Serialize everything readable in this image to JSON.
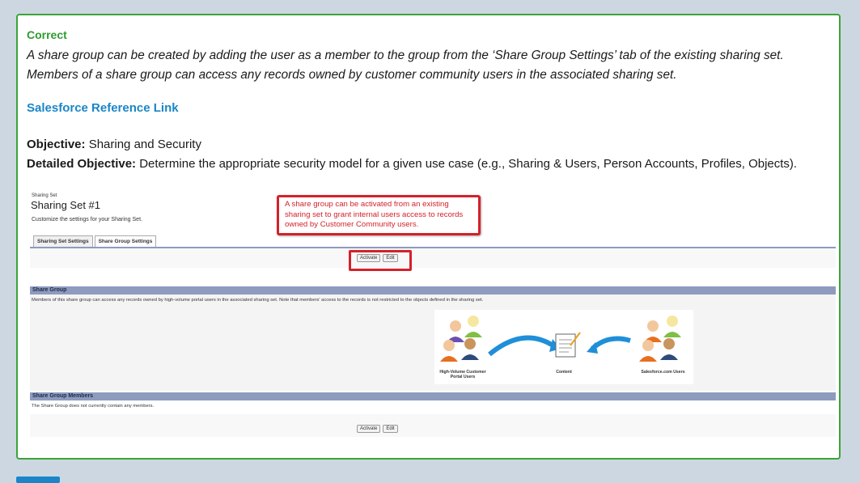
{
  "answer": {
    "status": "Correct",
    "explanation_line1": "A share group can be created by adding the user as a member to the group from the ‘Share Group Settings’ tab of the existing sharing set.",
    "explanation_line2": "Members of a share group can access any records owned by customer community users in the associated sharing set.",
    "reference_link": "Salesforce Reference Link",
    "objective_label": "Objective:",
    "objective_value": " Sharing and Security",
    "detailed_label": "Detailed Objective:",
    "detailed_value": " Determine the appropriate security model for a given use case (e.g., Sharing & Users, Person Accounts, Profiles, Objects)."
  },
  "screenshot": {
    "crumb": "Sharing Set",
    "title": "Sharing Set #1",
    "subtitle": "Customize the settings for your Sharing Set.",
    "callout": "A share group can be activated from an existing sharing set to grant internal users access to records owned by Customer Community users.",
    "tabs": [
      "Sharing Set Settings",
      "Share Group Settings"
    ],
    "activate_label": "Activate",
    "edit_label": "Edit",
    "share_group_header": "Share Group",
    "share_group_desc": "Members of this share group can access any records owned by high-volume portal users in the associated sharing set. Note that members' access to the records is not restricted to the objects defined in the sharing set.",
    "diagram": {
      "left_label": "High-Volume Customer Portal Users",
      "center_label": "Content",
      "right_label": "Salesforce.com Users"
    },
    "members_header": "Share Group Members",
    "members_desc": "The Share Group does not currently contain any members."
  },
  "colors": {
    "card_border": "#3aa43a",
    "correct": "#2e9b2e",
    "link": "#1a86c8",
    "callout_red": "#d4212a",
    "section_bar": "#8e9bbe"
  }
}
